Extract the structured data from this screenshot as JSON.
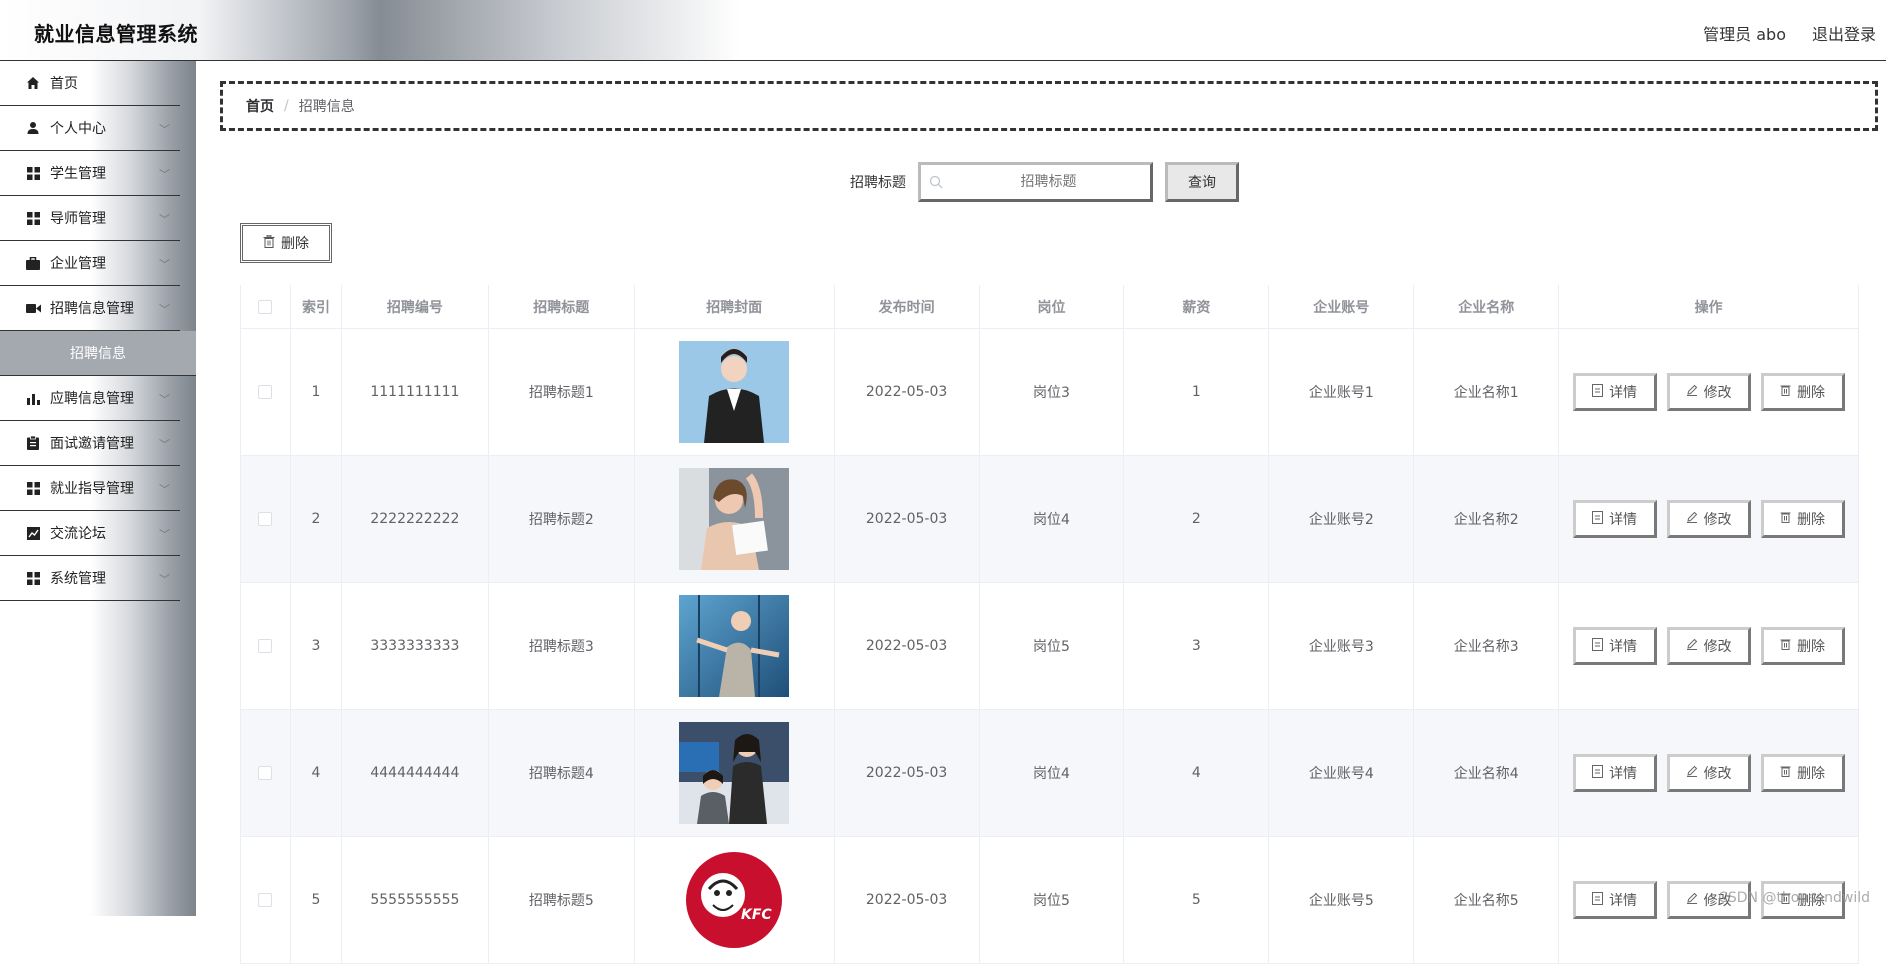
{
  "header": {
    "title": "就业信息管理系统",
    "user": "管理员 abo",
    "logout": "退出登录"
  },
  "sidebar": {
    "items": [
      {
        "label": "首页",
        "icon": "home-icon",
        "expandable": false
      },
      {
        "label": "个人中心",
        "icon": "user-icon",
        "expandable": true
      },
      {
        "label": "学生管理",
        "icon": "grid-icon",
        "expandable": true
      },
      {
        "label": "导师管理",
        "icon": "grid-icon",
        "expandable": true
      },
      {
        "label": "企业管理",
        "icon": "briefcase-icon",
        "expandable": true
      },
      {
        "label": "招聘信息管理",
        "icon": "video-icon",
        "expandable": true
      }
    ],
    "active_sub": "招聘信息",
    "items_after": [
      {
        "label": "应聘信息管理",
        "icon": "bar-chart-icon",
        "expandable": true
      },
      {
        "label": "面试邀请管理",
        "icon": "clipboard-icon",
        "expandable": true
      },
      {
        "label": "就业指导管理",
        "icon": "grid-icon",
        "expandable": true
      },
      {
        "label": "交流论坛",
        "icon": "line-chart-icon",
        "expandable": true
      },
      {
        "label": "系统管理",
        "icon": "grid-icon",
        "expandable": true
      }
    ]
  },
  "breadcrumb": {
    "home": "首页",
    "separator": "/",
    "current": "招聘信息"
  },
  "search": {
    "label": "招聘标题",
    "placeholder": "招聘标题",
    "button": "查询"
  },
  "toolbar": {
    "delete_label": "删除"
  },
  "table": {
    "columns": [
      "",
      "索引",
      "招聘编号",
      "招聘标题",
      "招聘封面",
      "发布时间",
      "岗位",
      "薪资",
      "企业账号",
      "企业名称",
      "操作"
    ],
    "actions": {
      "detail": "详情",
      "edit": "修改",
      "delete": "删除"
    },
    "rows": [
      {
        "index": "1",
        "code": "1111111111",
        "title": "招聘标题1",
        "date": "2022-05-03",
        "position": "岗位3",
        "salary": "1",
        "account": "企业账号1",
        "company": "企业名称1"
      },
      {
        "index": "2",
        "code": "2222222222",
        "title": "招聘标题2",
        "date": "2022-05-03",
        "position": "岗位4",
        "salary": "2",
        "account": "企业账号2",
        "company": "企业名称2"
      },
      {
        "index": "3",
        "code": "3333333333",
        "title": "招聘标题3",
        "date": "2022-05-03",
        "position": "岗位5",
        "salary": "3",
        "account": "企业账号3",
        "company": "企业名称3"
      },
      {
        "index": "4",
        "code": "4444444444",
        "title": "招聘标题4",
        "date": "2022-05-03",
        "position": "岗位4",
        "salary": "4",
        "account": "企业账号4",
        "company": "企业名称4"
      },
      {
        "index": "5",
        "code": "5555555555",
        "title": "招聘标题5",
        "date": "2022-05-03",
        "position": "岗位5",
        "salary": "5",
        "account": "企业账号5",
        "company": "企业名称5"
      }
    ]
  },
  "watermark": "CSDN @thousandwild",
  "colors": {
    "sidebar_active": "#a4a9b0",
    "row_stripe": "#f5f7fa",
    "table_border": "#ebeef5"
  }
}
